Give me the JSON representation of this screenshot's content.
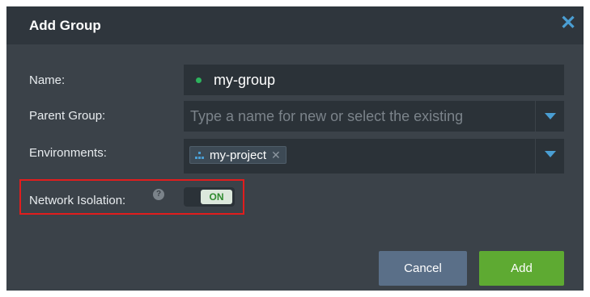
{
  "dialog": {
    "title": "Add Group"
  },
  "form": {
    "name_label": "Name:",
    "name_value": "my-group",
    "parent_label": "Parent Group:",
    "parent_placeholder": "Type a name for new or select the existing",
    "env_label": "Environments:",
    "env_chip": "my-project",
    "isolation_label": "Network Isolation:",
    "isolation_state": "ON"
  },
  "buttons": {
    "cancel": "Cancel",
    "add": "Add"
  },
  "colors": {
    "accent": "#4a9ed3",
    "add": "#5eaa32",
    "cancel": "#5a6f88",
    "highlight": "#e11d1d"
  },
  "icons": [
    "close-icon",
    "status-dot-icon",
    "dropdown-arrow-icon",
    "environment-icon",
    "remove-chip-icon",
    "help-icon"
  ]
}
